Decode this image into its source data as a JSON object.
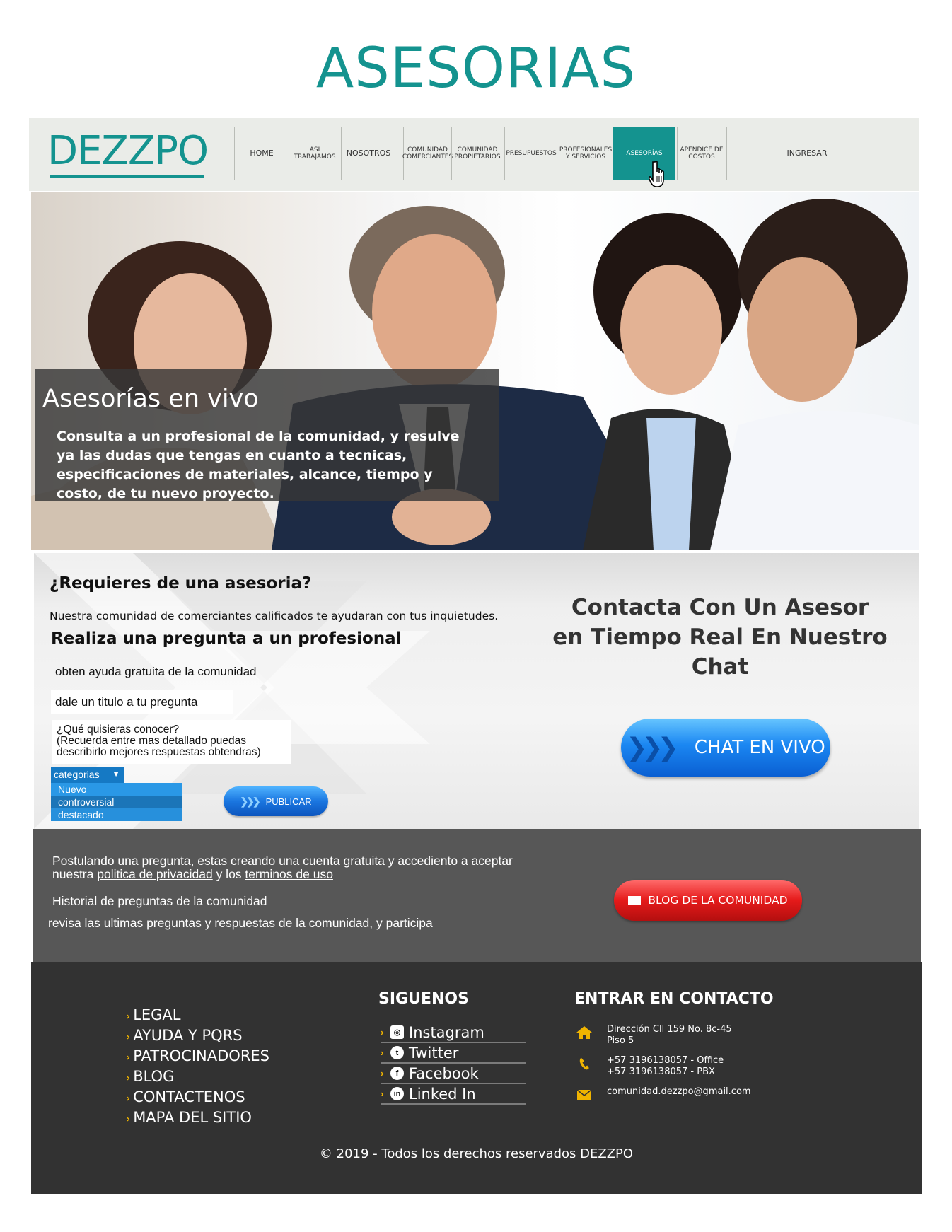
{
  "page": {
    "heading": "ASESORIAS"
  },
  "nav": {
    "logo": "DEZZPO",
    "items": [
      {
        "label": "HOME"
      },
      {
        "label": "ASI TRABAJAMOS"
      },
      {
        "label": "NOSOTROS"
      },
      {
        "label": "COMUNIDAD COMERCIANTES"
      },
      {
        "label": "COMUNIDAD PROPIETARIOS"
      },
      {
        "label": "PRESUPUESTOS"
      },
      {
        "label": "PROFESIONALES Y SERVICIOS"
      },
      {
        "label": "ASESORÍAS"
      },
      {
        "label": "APENDICE DE COSTOS"
      },
      {
        "label": "INGRESAR"
      }
    ],
    "active_color": "#14938f"
  },
  "hero": {
    "title": "Asesorías en vivo",
    "text": "Consulta a un profesional de la comunidad, y resulve ya las dudas que tengas en cuanto a tecnicas, especificaciones de materiales, alcance, tiempo y costo, de tu nuevo proyecto."
  },
  "form": {
    "title": "¿Requieres de una asesoria?",
    "subtitle": "Nuestra comunidad de comerciantes calificados te ayudaran con tus inquietudes.",
    "ask_heading": "Realiza una pregunta a un profesional",
    "help": "obten ayuda gratuita de la comunidad",
    "title_input_value": "dale un titulo a tu pregunta",
    "question_placeholder": "¿Qué quisieras conocer?\n(Recuerda entre mas detallado puedas describirlo mejores respuestas obtendras)",
    "category_label": "categorias",
    "category_options": [
      "Nuevo",
      "controversial",
      "destacado"
    ],
    "publish_label": "PUBLICAR"
  },
  "chat": {
    "heading_line1": "Contacta Con Un Asesor",
    "heading_line2": "en Tiempo Real En Nuestro Chat",
    "button_label": "CHAT EN VIVO"
  },
  "legal": {
    "text_before": "Postulando una pregunta, estas creando una cuenta gratuita y accediento a aceptar nuestra",
    "privacy_link": "politica de privacidad",
    "text_between": "y los",
    "terms_link": "terminos de uso",
    "history_title": "Historial de preguntas de la comunidad",
    "history_text": "revisa las ultimas preguntas y respuestas de la comunidad, y participa",
    "blog_button": "BLOG DE LA COMUNIDAD"
  },
  "footer": {
    "links": [
      "LEGAL",
      "AYUDA Y PQRS",
      "PATROCINADORES",
      "BLOG",
      "CONTACTENOS",
      "MAPA DEL SITIO"
    ],
    "follow_title": "SIGUENOS",
    "social": [
      {
        "label": "Instagram",
        "icon": "instagram-icon"
      },
      {
        "label": "Twitter",
        "icon": "twitter-icon"
      },
      {
        "label": "Facebook",
        "icon": "facebook-icon"
      },
      {
        "label": "Linked In",
        "icon": "linkedin-icon"
      }
    ],
    "contact_title": "ENTRAR EN CONTACTO",
    "address_line1": "Dirección  Cll 159 No. 8c-45",
    "address_line2": "Piso 5",
    "phone1": "+57 3196138057 - Office",
    "phone2": "+57 3196138057 - PBX",
    "email": "comunidad.dezzpo@gmail.com",
    "copyright": "© 2019 - Todos los derechos reservados DEZZPO",
    "accent_color": "#f0b400"
  }
}
